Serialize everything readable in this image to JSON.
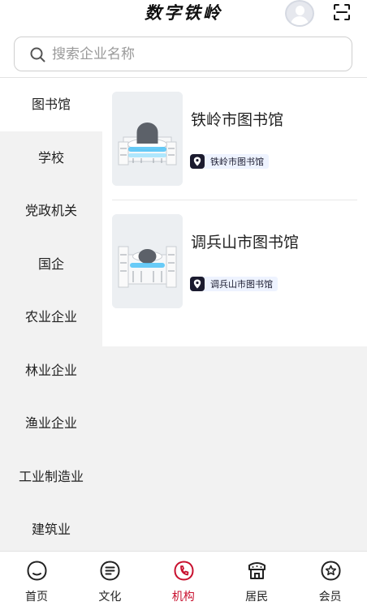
{
  "header": {
    "title": "数字铁岭",
    "avatar_icon": "user-avatar-icon",
    "scan_icon": "scan-icon"
  },
  "search": {
    "placeholder": "搜索企业名称",
    "value": ""
  },
  "sidebar": {
    "items": [
      {
        "label": "图书馆",
        "active": true
      },
      {
        "label": "学校",
        "active": false
      },
      {
        "label": "党政机关",
        "active": false
      },
      {
        "label": "国企",
        "active": false
      },
      {
        "label": "农业企业",
        "active": false
      },
      {
        "label": "林业企业",
        "active": false
      },
      {
        "label": "渔业企业",
        "active": false
      },
      {
        "label": "工业制造业",
        "active": false
      },
      {
        "label": "建筑业",
        "active": false
      }
    ]
  },
  "content": {
    "cards": [
      {
        "title": "铁岭市图书馆",
        "tag": "铁岭市图书馆",
        "tag_icon": "location-icon"
      },
      {
        "title": "调兵山市图书馆",
        "tag": "调兵山市图书馆",
        "tag_icon": "location-icon"
      }
    ]
  },
  "bottom_nav": {
    "items": [
      {
        "label": "首页",
        "icon": "home-icon",
        "active": false
      },
      {
        "label": "文化",
        "icon": "culture-icon",
        "active": false
      },
      {
        "label": "机构",
        "icon": "institution-icon",
        "active": true
      },
      {
        "label": "居民",
        "icon": "resident-icon",
        "active": false
      },
      {
        "label": "会员",
        "icon": "member-icon",
        "active": false
      }
    ]
  },
  "colors": {
    "accent": "#c8102e",
    "tag_bg": "#eef3ff",
    "tag_icon_bg": "#1b1b2f"
  }
}
